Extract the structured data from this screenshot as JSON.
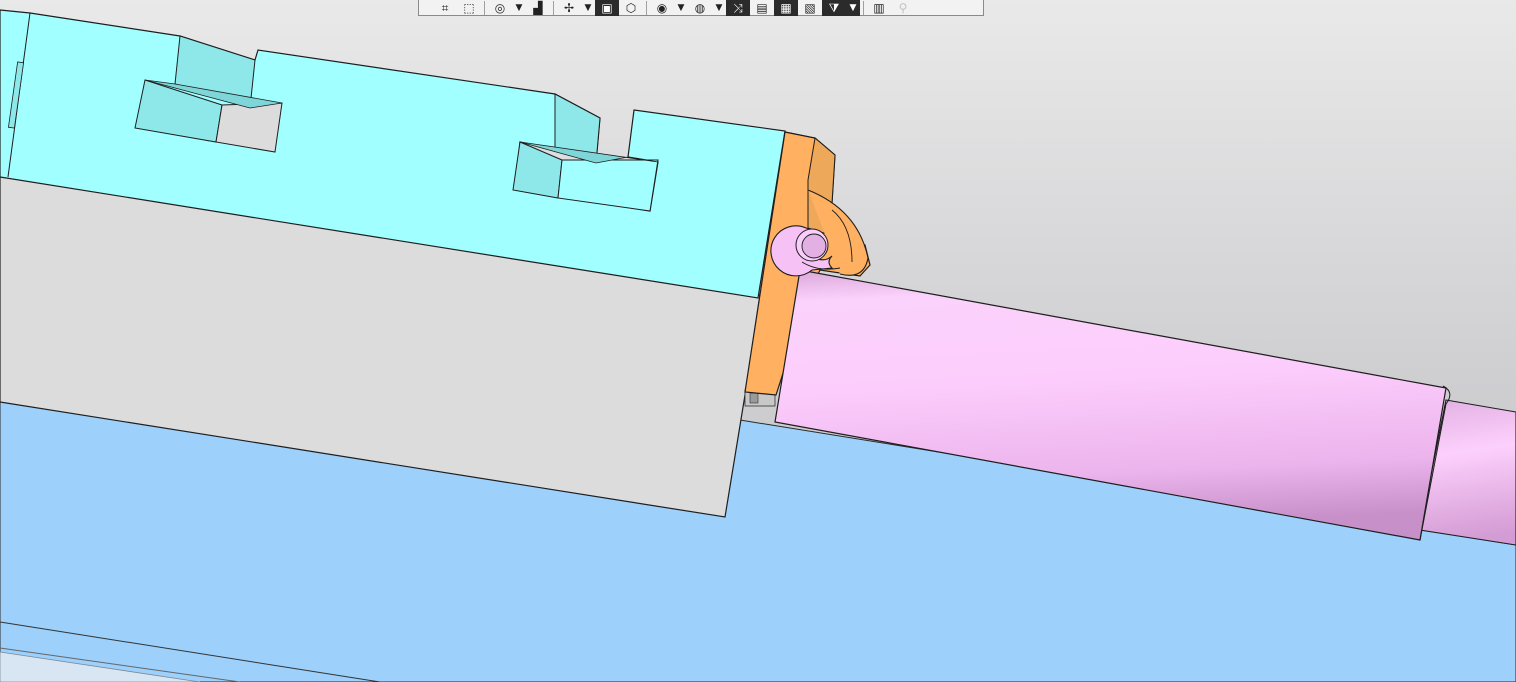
{
  "viewport": {
    "background_top": "#c4c4c8",
    "background_bottom": "#eaeaea",
    "colors": {
      "slide_block": "#a2ffff",
      "slide_block_shade": "#8ee8ea",
      "base_plate": "#dcdcdc",
      "bracket": "#ffb060",
      "bracket_shade": "#eea85a",
      "cylinder": "#f8c8f8",
      "plate_blue": "#9dd0fb",
      "edge": "#222222"
    },
    "parts": [
      "slide-block",
      "base-plate",
      "orange-bracket",
      "pink-cylinder",
      "blue-plate"
    ]
  },
  "toolbar": {
    "buttons": [
      {
        "icon": "zoom-to-fit-icon",
        "glyph": "⌗",
        "active": false
      },
      {
        "icon": "zoom-area-icon",
        "glyph": "⬚",
        "active": false
      },
      {
        "icon": "previous-view-icon",
        "glyph": "◎",
        "active": false,
        "dropdown": true
      },
      {
        "icon": "section-view-icon",
        "glyph": "▟",
        "active": false
      },
      {
        "icon": "dynamic-annotation-icon",
        "glyph": "✢",
        "active": false,
        "dropdown": true
      },
      {
        "icon": "view-orientation-icon",
        "glyph": "▣",
        "active": true
      },
      {
        "icon": "display-style-icon",
        "glyph": "⬡",
        "active": false
      },
      {
        "icon": "hide-show-icon",
        "glyph": "◉",
        "active": false,
        "dropdown": true
      },
      {
        "icon": "edit-appearance-icon",
        "glyph": "◍",
        "active": false,
        "dropdown": true
      },
      {
        "icon": "scene-icon",
        "glyph": "⤨",
        "active": true
      },
      {
        "icon": "view-settings-icon",
        "glyph": "▤",
        "active": false
      },
      {
        "icon": "rendering-icon",
        "glyph": "▦",
        "active": true
      },
      {
        "icon": "photoview-icon",
        "glyph": "▧",
        "active": false
      },
      {
        "icon": "filter-icon",
        "glyph": "⧩",
        "active": true,
        "dropdown": true
      },
      {
        "icon": "monitor-icon",
        "glyph": "▥",
        "active": false
      },
      {
        "icon": "pin-icon",
        "glyph": "⚲",
        "active": false,
        "disabled": true
      }
    ]
  }
}
